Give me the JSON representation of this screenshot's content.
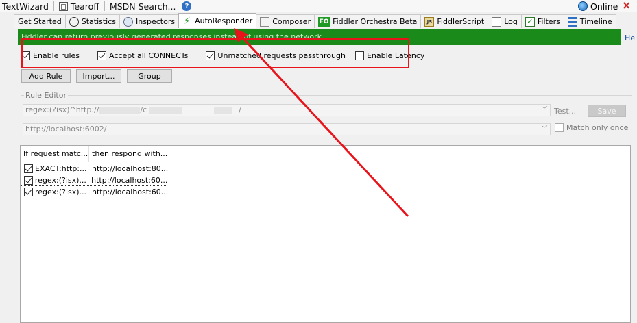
{
  "toolbar": {
    "textwizard": "TextWizard",
    "tearoff": "Tearoff",
    "msdn_search": "MSDN Search...",
    "online": "Online"
  },
  "tabs": [
    {
      "label": "Get Started",
      "icon": ""
    },
    {
      "label": "Statistics",
      "icon": "clock-icon"
    },
    {
      "label": "Inspectors",
      "icon": "inspectors-icon"
    },
    {
      "label": "AutoResponder",
      "icon": "lightning-icon",
      "active": true
    },
    {
      "label": "Composer",
      "icon": "composer-icon"
    },
    {
      "label": "Fiddler Orchestra Beta",
      "icon": "fo-icon",
      "icon_text": "FO"
    },
    {
      "label": "FiddlerScript",
      "icon": "script-icon",
      "icon_text": "JS"
    },
    {
      "label": "Log",
      "icon": "log-icon"
    },
    {
      "label": "Filters",
      "icon": "checkbox-icon"
    },
    {
      "label": "Timeline",
      "icon": "timeline-icon"
    }
  ],
  "banner": {
    "text": "Fiddler can return previously generated responses instead of using the network.",
    "help": "Help",
    "color": "#1a8a1a"
  },
  "options": {
    "enable_rules": {
      "label": "Enable rules",
      "checked": true
    },
    "accept_connects": {
      "label": "Accept all CONNECTs",
      "checked": true
    },
    "unmatched_passthrough": {
      "label": "Unmatched requests passthrough",
      "checked": true
    },
    "enable_latency": {
      "label": "Enable Latency",
      "checked": false
    }
  },
  "buttons": {
    "add_rule": "Add Rule",
    "import": "Import...",
    "group": "Group"
  },
  "rule_editor": {
    "legend": "Rule Editor",
    "match_value_a": "regex:(?isx)^http://",
    "match_value_b": "/c",
    "match_value_c": "/",
    "response_value": "http://localhost:6002/",
    "test_label": "Test...",
    "save_label": "Save",
    "match_once_label": "Match only once"
  },
  "rules_list": {
    "columns": [
      "If request matc...",
      "then respond with..."
    ],
    "rows": [
      {
        "match": "EXACT:http:...",
        "response": "http://localhost:80...",
        "checked": true
      },
      {
        "match": "regex:(?isx)...",
        "response": "http://localhost:60...",
        "checked": true,
        "selected": true
      },
      {
        "match": "regex:(?isx)...",
        "response": "http://localhost:60...",
        "checked": true
      }
    ]
  },
  "colors": {
    "annotation": "#e8141c"
  }
}
